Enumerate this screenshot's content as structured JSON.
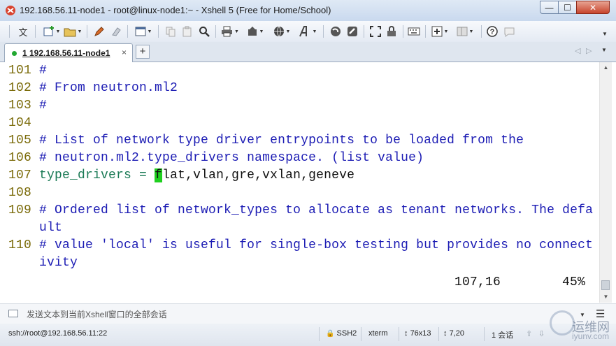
{
  "window": {
    "title": "192.168.56.11-node1 - root@linux-node1:~ - Xshell 5 (Free for Home/School)",
    "controls": {
      "minimize": "—",
      "maximize": "☐",
      "close": "✕"
    }
  },
  "toolbar": {
    "lang_button": "文",
    "icons": [
      "new-session-icon",
      "open-folder-icon",
      "pen-icon",
      "eraser-icon",
      "properties-icon",
      "copy-icon",
      "paste-icon",
      "find-icon",
      "print-icon",
      "transfer-icon",
      "globe-icon",
      "font-icon",
      "xftp-icon",
      "xshell-icon",
      "fullscreen-icon",
      "lock-icon",
      "keyboard-icon",
      "add-icon",
      "layout-icon",
      "help-icon",
      "chat-icon"
    ]
  },
  "tabs": [
    {
      "label": "1 192.168.56.11-node1",
      "close": "×",
      "active": true,
      "status_color": "#22a832"
    }
  ],
  "tabbar": {
    "add": "+"
  },
  "terminal": {
    "lines": [
      {
        "num": "101",
        "text": " #"
      },
      {
        "num": "102",
        "text": " # From neutron.ml2"
      },
      {
        "num": "103",
        "text": " #"
      },
      {
        "num": "104",
        "text": ""
      },
      {
        "num": "105",
        "text": " # List of network type driver entrypoints to be loaded from the"
      },
      {
        "num": "106",
        "text": " # neutron.ml2.type_drivers namespace. (list value)"
      },
      {
        "num": "108",
        "text": ""
      },
      {
        "num": "109",
        "text": " # Ordered list of network_types to allocate as tenant networks. The defa"
      },
      {
        "num": "110",
        "text": " # value 'local' is useful for single-box testing but provides no connect"
      }
    ],
    "line107": {
      "num": "107",
      "pre": " type_drivers = ",
      "cursor": "f",
      "post": "lat,vlan,gre,vxlan,geneve"
    },
    "wrap109": "    ult",
    "wrap110": "    ivity",
    "cursor_position": "107,16",
    "scroll_percent": "45%",
    "colors": {
      "line_number": "#7a6a08",
      "comment": "#1c1cb4",
      "code": "#1a7a55",
      "cursor": "#1fd01f"
    }
  },
  "compose": {
    "placeholder": "发送文本到当前Xshell窗口的全部会话"
  },
  "statusbar": {
    "connection": "ssh://root@192.168.56.11:22",
    "protocol": "SSH2",
    "terminal_type": "xterm",
    "size": "76x13",
    "cursor": "7,20",
    "sessions": "1 会话",
    "watermark_line1": "运维网",
    "watermark_line2": "iyunv.com"
  }
}
